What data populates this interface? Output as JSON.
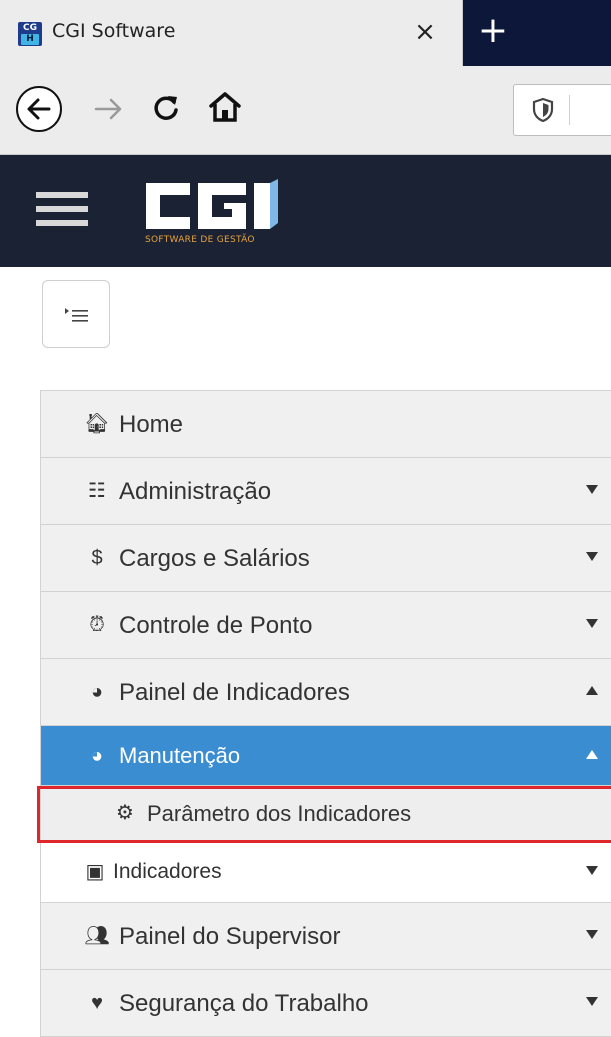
{
  "browser": {
    "tab_title": "CGI Software",
    "tab_close": "×",
    "new_tab": "+",
    "favicon_top": "CG",
    "favicon_bottom": "H"
  },
  "app": {
    "logo_text": "CGI",
    "logo_subtitle": "SOFTWARE DE GESTÃO",
    "colors": {
      "header_bg": "#1b2233",
      "tabbar_bg": "#0c1739",
      "active_item": "#3b8dd2",
      "highlight": "#e0262d"
    }
  },
  "menu": {
    "items": [
      {
        "label": "Home",
        "icon": "home-icon",
        "glyph": "🏠︎",
        "caret": ""
      },
      {
        "label": "Administração",
        "icon": "list-icon",
        "glyph": "☷",
        "caret": "down"
      },
      {
        "label": "Cargos e Salários",
        "icon": "dollar-icon",
        "glyph": "$",
        "caret": "down"
      },
      {
        "label": "Controle de Ponto",
        "icon": "alarm-clock-icon",
        "glyph": "⏰︎",
        "caret": "down"
      },
      {
        "label": "Painel de Indicadores",
        "icon": "globe-icon",
        "glyph": "◕",
        "caret": "up"
      },
      {
        "label": "Manutenção",
        "icon": "globe-icon",
        "glyph": "◕",
        "caret": "up"
      },
      {
        "label": "Parâmetro dos Indicadores",
        "icon": "gear-icon",
        "glyph": "⚙",
        "caret": ""
      },
      {
        "label": "Indicadores",
        "icon": "picture-icon",
        "glyph": "▣",
        "caret": "down"
      },
      {
        "label": "Painel do Supervisor",
        "icon": "users-icon",
        "glyph": "👥︎",
        "caret": "down"
      },
      {
        "label": "Segurança do Trabalho",
        "icon": "heart-icon",
        "glyph": "♥",
        "caret": "down"
      }
    ]
  }
}
